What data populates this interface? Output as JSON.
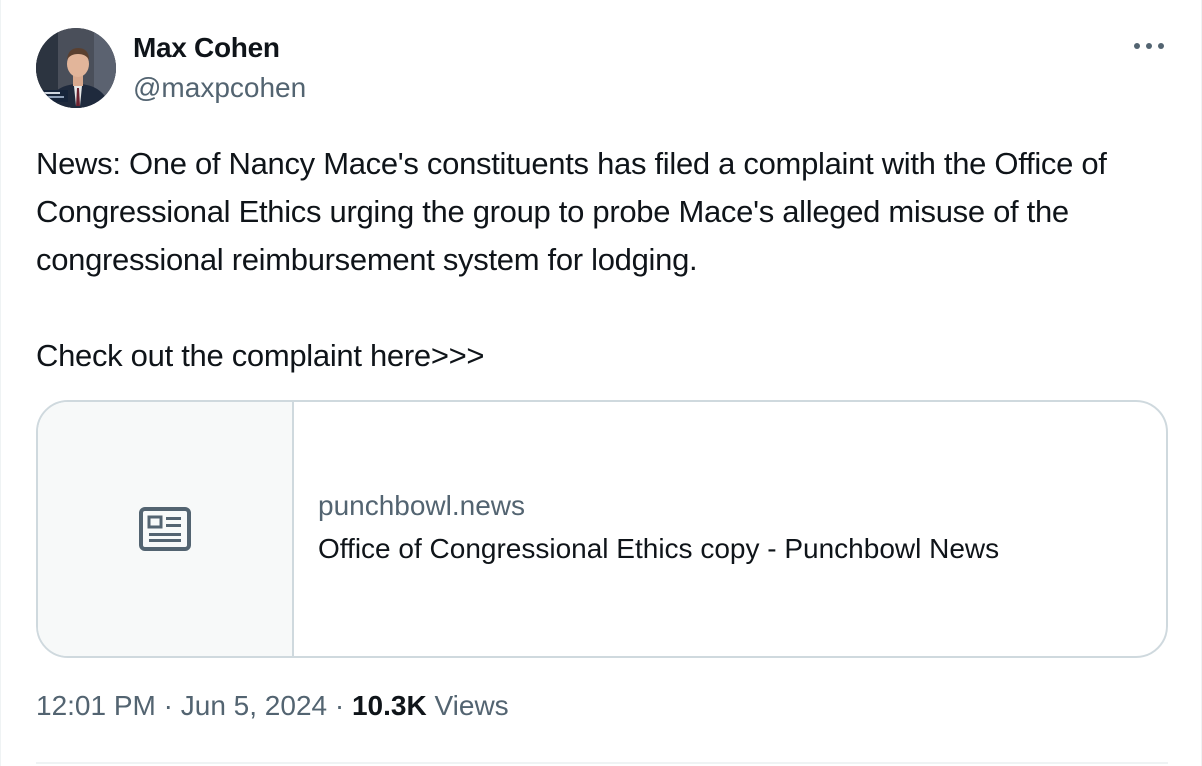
{
  "author": {
    "name": "Max Cohen",
    "handle": "@maxpcohen"
  },
  "tweet": {
    "paragraphs": [
      "News: One of Nancy Mace's constituents has filed a complaint with the Office of Congressional Ethics urging the group to probe Mace's alleged misuse of the congressional reimbursement system for lodging.",
      "Check out the complaint here>>>"
    ]
  },
  "link_card": {
    "domain": "punchbowl.news",
    "title": "Office of Congressional Ethics copy - Punchbowl News",
    "icon": "newspaper-icon"
  },
  "meta": {
    "time": "12:01 PM",
    "separator": "·",
    "date": "Jun 5, 2024",
    "views_count": "10.3K",
    "views_label": "Views"
  },
  "icons": {
    "more": "more-horizontal-icon"
  },
  "colors": {
    "text_primary": "#0f1419",
    "text_secondary": "#536471",
    "border": "#cfd9de",
    "card_bg": "#f7f9f9"
  }
}
